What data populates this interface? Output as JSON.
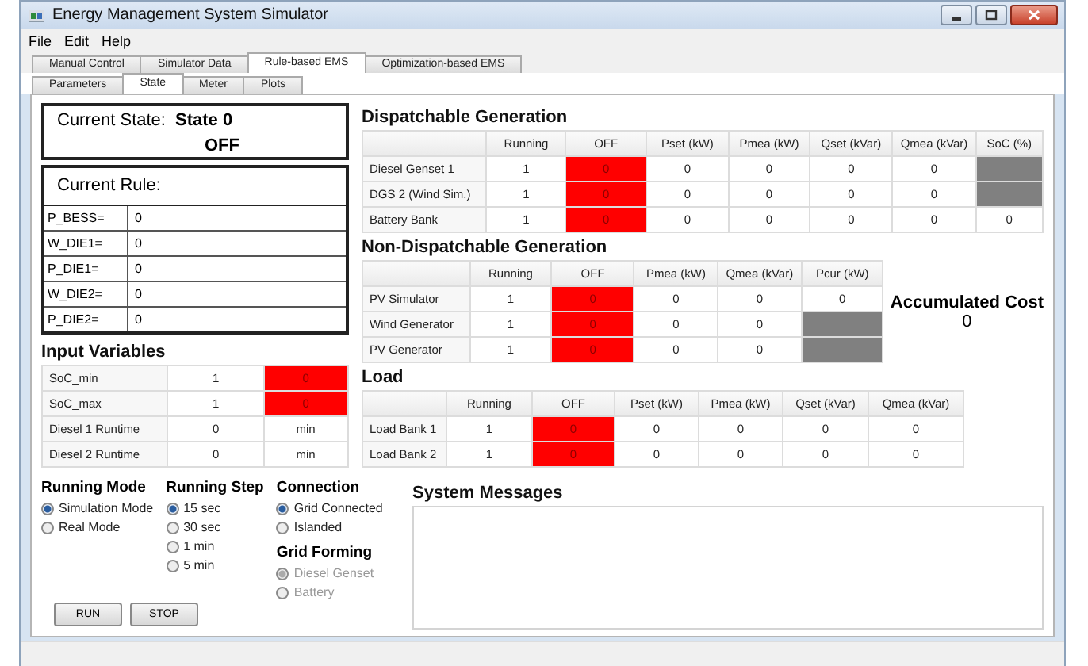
{
  "window": {
    "title": "Energy Management System Simulator"
  },
  "menu": [
    "File",
    "Edit",
    "Help"
  ],
  "tabs": [
    {
      "label": "Manual Control",
      "selected": false
    },
    {
      "label": "Simulator Data",
      "selected": false
    },
    {
      "label": "Rule-based EMS",
      "selected": true
    },
    {
      "label": "Optimization-based EMS",
      "selected": false
    }
  ],
  "subtabs": [
    {
      "label": "Parameters",
      "selected": false
    },
    {
      "label": "State",
      "selected": true
    },
    {
      "label": "Meter",
      "selected": false
    },
    {
      "label": "Plots",
      "selected": false
    }
  ],
  "current_state": {
    "label": "Current State:",
    "state": "State 0",
    "status": "OFF"
  },
  "current_rule": {
    "label": "Current Rule:",
    "rows": [
      {
        "name": "P_BESS=",
        "value": "0"
      },
      {
        "name": "W_DIE1=",
        "value": "0"
      },
      {
        "name": "P_DIE1=",
        "value": "0"
      },
      {
        "name": "W_DIE2=",
        "value": "0"
      },
      {
        "name": "P_DIE2=",
        "value": "0"
      }
    ]
  },
  "input_variables": {
    "title": "Input Variables",
    "rows": [
      {
        "label": "SoC_min",
        "cells": [
          {
            "kind": "value",
            "text": "1"
          },
          {
            "kind": "alarm",
            "text": "0"
          }
        ]
      },
      {
        "label": "SoC_max",
        "cells": [
          {
            "kind": "value",
            "text": "1"
          },
          {
            "kind": "alarm",
            "text": "0"
          }
        ]
      },
      {
        "label": "Diesel 1 Runtime",
        "cells": [
          {
            "kind": "value",
            "text": "0"
          },
          {
            "kind": "value",
            "text": "min"
          }
        ]
      },
      {
        "label": "Diesel 2 Runtime",
        "cells": [
          {
            "kind": "value",
            "text": "0"
          },
          {
            "kind": "value",
            "text": "min"
          }
        ]
      }
    ]
  },
  "dispatchable": {
    "title": "Dispatchable Generation",
    "columns": [
      "Running",
      "OFF",
      "Pset (kW)",
      "Pmea (kW)",
      "Qset (kVar)",
      "Qmea (kVar)",
      "SoC (%)"
    ],
    "rows": [
      {
        "label": "Diesel Genset 1",
        "cells": [
          {
            "kind": "value",
            "text": "1"
          },
          {
            "kind": "alarm",
            "text": "0"
          },
          {
            "kind": "value",
            "text": "0"
          },
          {
            "kind": "value",
            "text": "0"
          },
          {
            "kind": "value",
            "text": "0"
          },
          {
            "kind": "value",
            "text": "0"
          },
          {
            "kind": "blank"
          }
        ]
      },
      {
        "label": "DGS 2 (Wind Sim.)",
        "cells": [
          {
            "kind": "value",
            "text": "1"
          },
          {
            "kind": "alarm",
            "text": "0"
          },
          {
            "kind": "value",
            "text": "0"
          },
          {
            "kind": "value",
            "text": "0"
          },
          {
            "kind": "value",
            "text": "0"
          },
          {
            "kind": "value",
            "text": "0"
          },
          {
            "kind": "blank"
          }
        ]
      },
      {
        "label": "Battery Bank",
        "cells": [
          {
            "kind": "value",
            "text": "1"
          },
          {
            "kind": "alarm",
            "text": "0"
          },
          {
            "kind": "value",
            "text": "0"
          },
          {
            "kind": "value",
            "text": "0"
          },
          {
            "kind": "value",
            "text": "0"
          },
          {
            "kind": "value",
            "text": "0"
          },
          {
            "kind": "value",
            "text": "0"
          }
        ]
      }
    ]
  },
  "non_dispatchable": {
    "title": "Non-Dispatchable Generation",
    "columns": [
      "Running",
      "OFF",
      "Pmea (kW)",
      "Qmea (kVar)",
      "Pcur (kW)"
    ],
    "rows": [
      {
        "label": "PV Simulator",
        "cells": [
          {
            "kind": "value",
            "text": "1"
          },
          {
            "kind": "alarm",
            "text": "0"
          },
          {
            "kind": "value",
            "text": "0"
          },
          {
            "kind": "value",
            "text": "0"
          },
          {
            "kind": "value",
            "text": "0"
          }
        ]
      },
      {
        "label": "Wind Generator",
        "cells": [
          {
            "kind": "value",
            "text": "1"
          },
          {
            "kind": "alarm",
            "text": "0"
          },
          {
            "kind": "value",
            "text": "0"
          },
          {
            "kind": "value",
            "text": "0"
          },
          {
            "kind": "blank"
          }
        ]
      },
      {
        "label": "PV Generator",
        "cells": [
          {
            "kind": "value",
            "text": "1"
          },
          {
            "kind": "alarm",
            "text": "0"
          },
          {
            "kind": "value",
            "text": "0"
          },
          {
            "kind": "value",
            "text": "0"
          },
          {
            "kind": "blank"
          }
        ]
      }
    ]
  },
  "accumulated_cost": {
    "label": "Accumulated Cost",
    "value": "0"
  },
  "load": {
    "title": "Load",
    "columns": [
      "Running",
      "OFF",
      "Pset (kW)",
      "Pmea (kW)",
      "Qset (kVar)",
      "Qmea (kVar)"
    ],
    "rows": [
      {
        "label": "Load Bank 1",
        "cells": [
          {
            "kind": "value",
            "text": "1"
          },
          {
            "kind": "alarm",
            "text": "0"
          },
          {
            "kind": "value",
            "text": "0"
          },
          {
            "kind": "value",
            "text": "0"
          },
          {
            "kind": "value",
            "text": "0"
          },
          {
            "kind": "value",
            "text": "0"
          }
        ]
      },
      {
        "label": "Load Bank 2",
        "cells": [
          {
            "kind": "value",
            "text": "1"
          },
          {
            "kind": "alarm",
            "text": "0"
          },
          {
            "kind": "value",
            "text": "0"
          },
          {
            "kind": "value",
            "text": "0"
          },
          {
            "kind": "value",
            "text": "0"
          },
          {
            "kind": "value",
            "text": "0"
          }
        ]
      }
    ]
  },
  "option_columns": [
    [
      {
        "title": "Running Mode",
        "options": [
          {
            "label": "Simulation Mode",
            "selected": true,
            "disabled": false
          },
          {
            "label": "Real Mode",
            "selected": false,
            "disabled": false
          }
        ]
      }
    ],
    [
      {
        "title": "Running Step",
        "options": [
          {
            "label": "15 sec",
            "selected": true,
            "disabled": false
          },
          {
            "label": "30 sec",
            "selected": false,
            "disabled": false
          },
          {
            "label": "1 min",
            "selected": false,
            "disabled": false
          },
          {
            "label": "5 min",
            "selected": false,
            "disabled": false
          }
        ]
      }
    ],
    [
      {
        "title": "Connection",
        "options": [
          {
            "label": "Grid Connected",
            "selected": true,
            "disabled": false
          },
          {
            "label": "Islanded",
            "selected": false,
            "disabled": false
          }
        ]
      },
      {
        "title": "Grid Forming",
        "options": [
          {
            "label": "Diesel Genset",
            "selected": true,
            "disabled": true
          },
          {
            "label": "Battery",
            "selected": false,
            "disabled": true
          }
        ]
      }
    ]
  ],
  "buttons": [
    "RUN",
    "STOP"
  ],
  "system_messages": {
    "title": "System Messages"
  }
}
